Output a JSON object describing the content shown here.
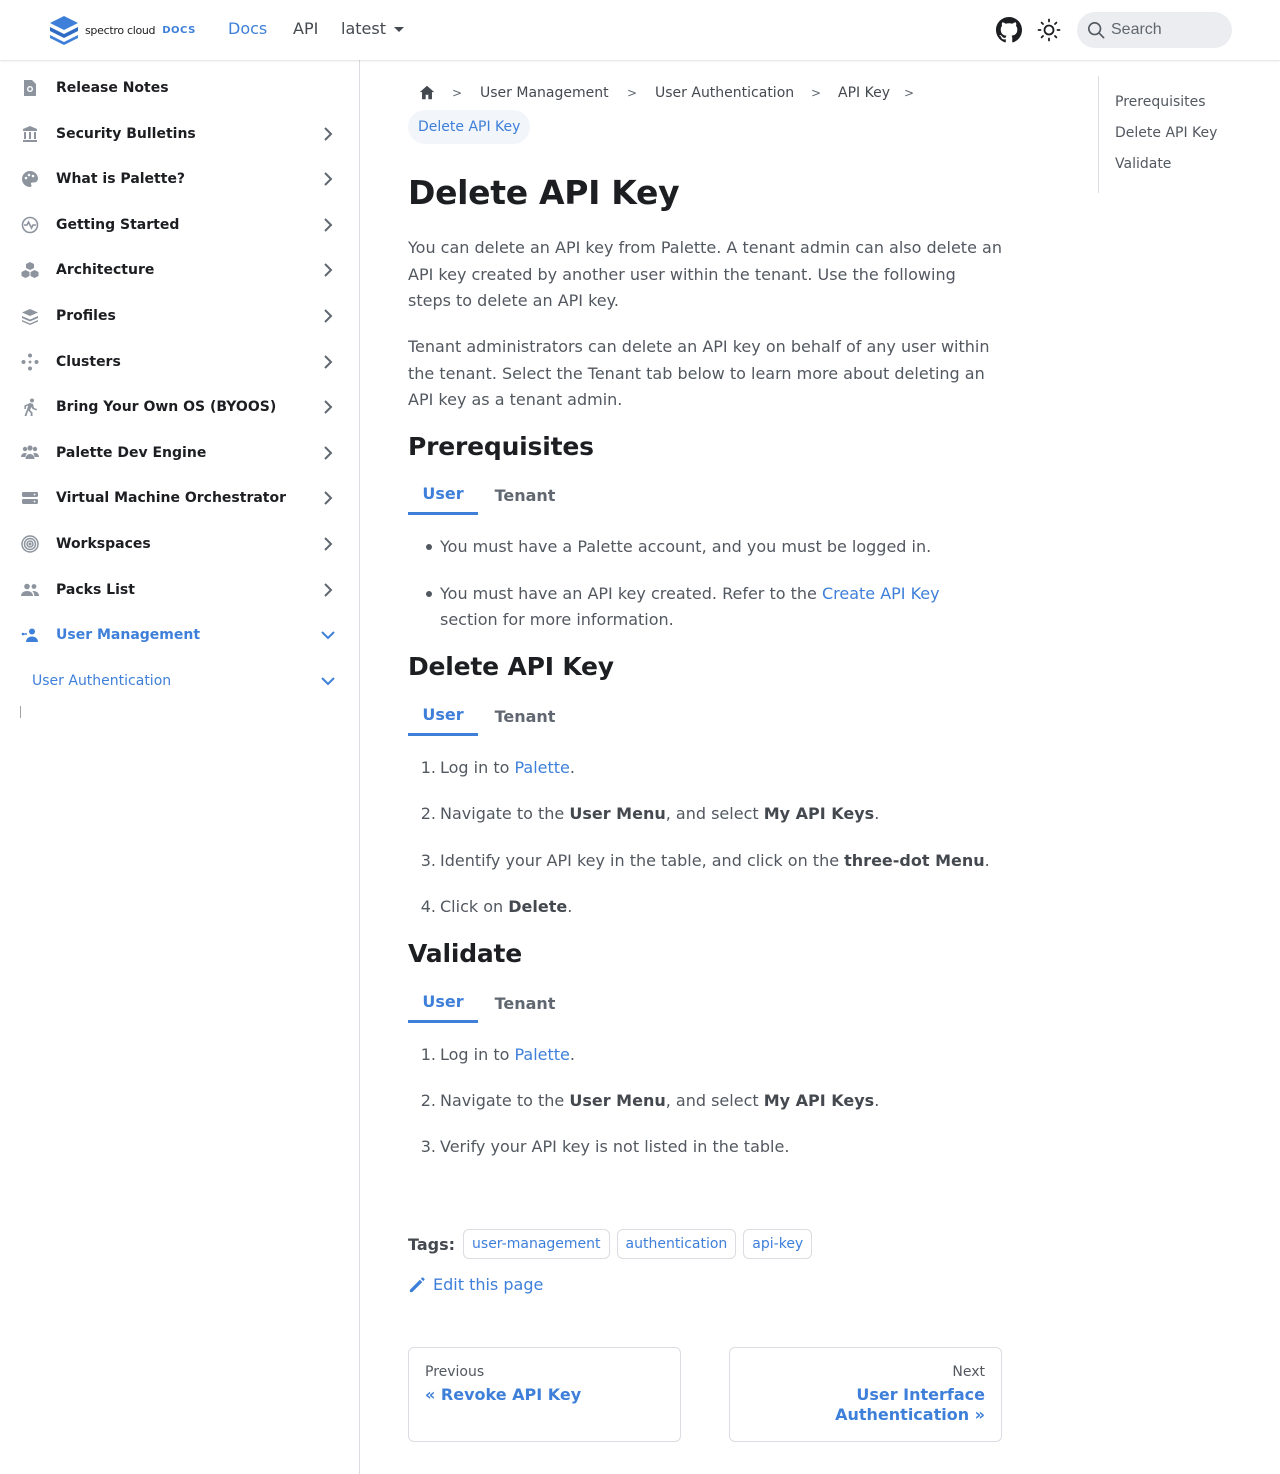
{
  "navbar": {
    "brand_name": "spectro cloud",
    "brand_docs": "DOCS",
    "links": {
      "docs": "Docs",
      "api": "API",
      "version": "latest"
    },
    "search_placeholder": "Search",
    "accent_color": "#3e7fd9"
  },
  "sidebar": {
    "items": [
      {
        "label": "Release Notes",
        "icon": "release-notes-icon"
      },
      {
        "label": "Security Bulletins",
        "icon": "security-bulletin-icon"
      },
      {
        "label": "What is Palette?",
        "icon": "palette-icon"
      },
      {
        "label": "Getting Started",
        "icon": "pulse-icon"
      },
      {
        "label": "Architecture",
        "icon": "cubes-icon"
      },
      {
        "label": "Profiles",
        "icon": "layers-icon"
      },
      {
        "label": "Clusters",
        "icon": "clusters-icon"
      },
      {
        "label": "Bring Your Own OS (BYOOS)",
        "icon": "person-walking-icon"
      },
      {
        "label": "Palette Dev Engine",
        "icon": "users-icon"
      },
      {
        "label": "Virtual Machine Orchestrator",
        "icon": "server-icon"
      },
      {
        "label": "Workspaces",
        "icon": "target-icon"
      },
      {
        "label": "Packs List",
        "icon": "people-icon"
      },
      {
        "label": "User Management",
        "icon": "user-management-icon"
      }
    ],
    "sub_item": "User Authentication"
  },
  "breadcrumbs": {
    "items": [
      "User Management",
      "User Authentication",
      "API Key"
    ],
    "active": "Delete API Key"
  },
  "content": {
    "title": "Delete API Key",
    "intro_1": "You can delete an API key from Palette. A tenant admin can also delete an API key created by another user within the tenant. Use the following steps to delete an API key.",
    "intro_2": "Tenant administrators can delete an API key on behalf of any user within the tenant. Select the Tenant tab below to learn more about deleting an API key as a tenant admin.",
    "tabs": {
      "user": "User",
      "tenant": "Tenant"
    },
    "prereq": {
      "heading": "Prerequisites",
      "item_1": "You must have a Palette account, and you must be logged in.",
      "item_2_before": "You must have an API key created. Refer to the ",
      "item_2_link": "Create API Key",
      "item_2_after": " section for more information."
    },
    "delete": {
      "heading": "Delete API Key",
      "step_1_before": "Log in to ",
      "step_1_link": "Palette",
      "step_1_after": ".",
      "step_2_before": "Navigate to the ",
      "step_2_bold_1": "User Menu",
      "step_2_mid": ", and select ",
      "step_2_bold_2": "My API Keys",
      "step_2_after": ".",
      "step_3_before": "Identify your API key in the table, and click on the ",
      "step_3_bold": "three-dot Menu",
      "step_3_after": ".",
      "step_4_before": "Click on ",
      "step_4_bold": "Delete",
      "step_4_after": "."
    },
    "validate": {
      "heading": "Validate",
      "step_1_before": "Log in to ",
      "step_1_link": "Palette",
      "step_1_after": ".",
      "step_2_before": "Navigate to the ",
      "step_2_bold_1": "User Menu",
      "step_2_mid": ", and select ",
      "step_2_bold_2": "My API Keys",
      "step_2_after": ".",
      "step_3": "Verify your API key is not listed in the table."
    },
    "tags_label": "Tags:",
    "tags": [
      "user-management",
      "authentication",
      "api-key"
    ],
    "edit_label": "Edit this page",
    "pager": {
      "prev_sub": "Previous",
      "prev_label": "« Revoke API Key",
      "next_sub": "Next",
      "next_label_1": "User Interface",
      "next_label_2": "Authentication »"
    }
  },
  "toc": [
    "Prerequisites",
    "Delete API Key",
    "Validate"
  ]
}
